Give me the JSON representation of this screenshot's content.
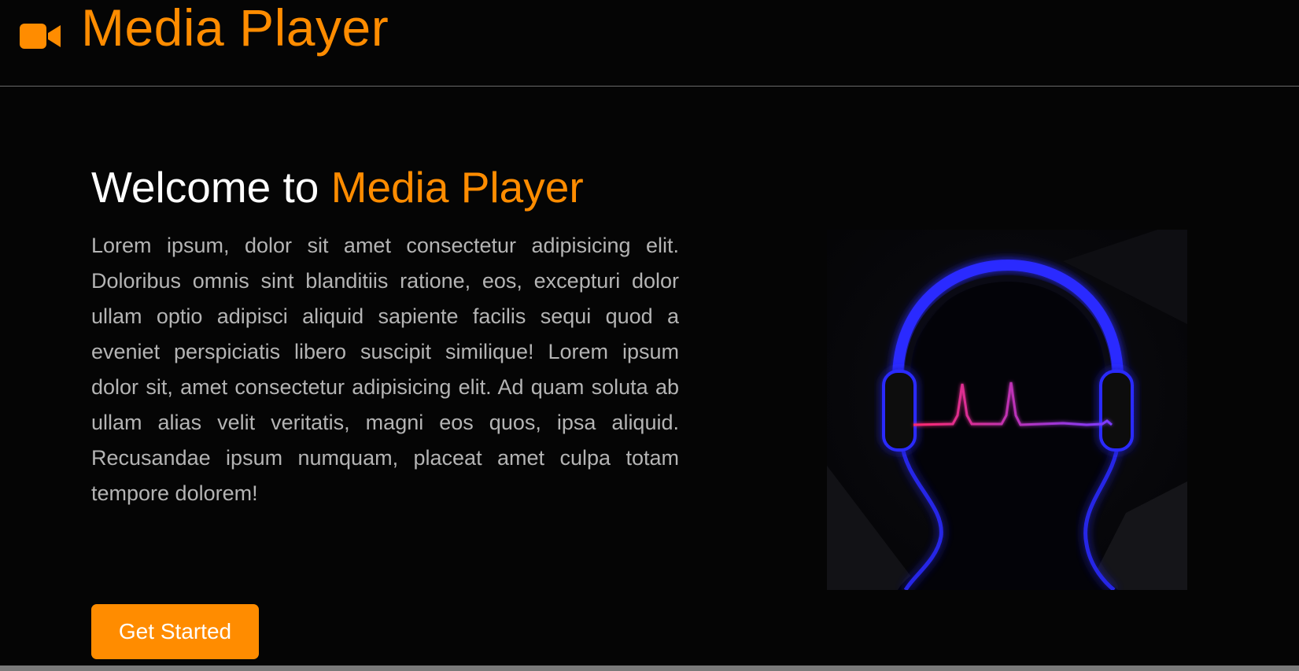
{
  "colors": {
    "accent": "#ff8c00",
    "background": "#050505",
    "text_primary": "#ffffff",
    "text_muted": "#b4b4b4",
    "headphone_glow": "#2a2aff",
    "pulse_start": "#ff2a6d",
    "pulse_end": "#7a3bff"
  },
  "header": {
    "logo_icon": "video-camera-icon",
    "brand_name": "Media Player"
  },
  "hero": {
    "title_prefix": "Welcome to ",
    "title_highlight": "Media Player",
    "description": "Lorem ipsum, dolor sit amet consectetur adipisicing elit. Doloribus omnis sint blanditiis ratione, eos, excepturi dolor ullam optio adipisci aliquid sapiente facilis sequi quod a eveniet perspiciatis libero suscipit similique! Lorem ipsum dolor sit, amet consectetur adipisicing elit. Ad quam soluta ab ullam alias velit veritatis, magni eos quos, ipsa aliquid. Recusandae ipsum numquam, placeat amet culpa totam tempore dolorem!",
    "cta_label": "Get Started",
    "image_icon": "headphones-heartbeat-illustration"
  }
}
